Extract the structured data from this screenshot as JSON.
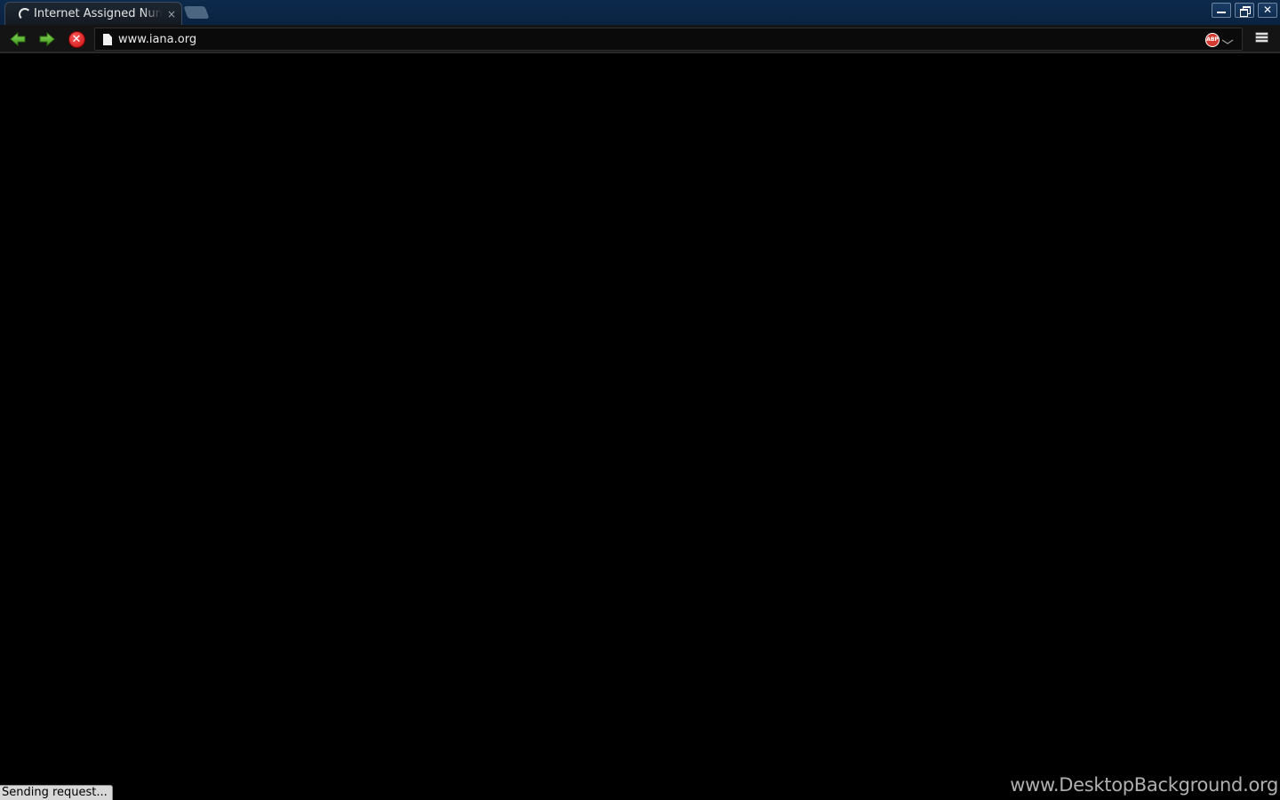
{
  "tabs": [
    {
      "title": "Internet Assigned Numbers Authority",
      "close_glyph": "×",
      "loading": true
    }
  ],
  "window_controls": {
    "close_glyph": "✕"
  },
  "toolbar": {
    "stop_glyph": "✕",
    "abp_label": "ABP"
  },
  "omnibox": {
    "url": "www.iana.org"
  },
  "status": {
    "text": "Sending request..."
  },
  "watermark": {
    "text": "www.DesktopBackground.org"
  },
  "colors": {
    "tabstrip": "#0d2a4c",
    "toolbar": "#141414",
    "content": "#000000",
    "nav_arrow": "#4fae2d",
    "stop": "#d41a1a"
  },
  "icons": {
    "back": "back-arrow-icon",
    "forward": "forward-arrow-icon",
    "stop": "stop-icon",
    "page": "page-icon",
    "adblock": "abp-icon",
    "menu": "menu-icon"
  }
}
